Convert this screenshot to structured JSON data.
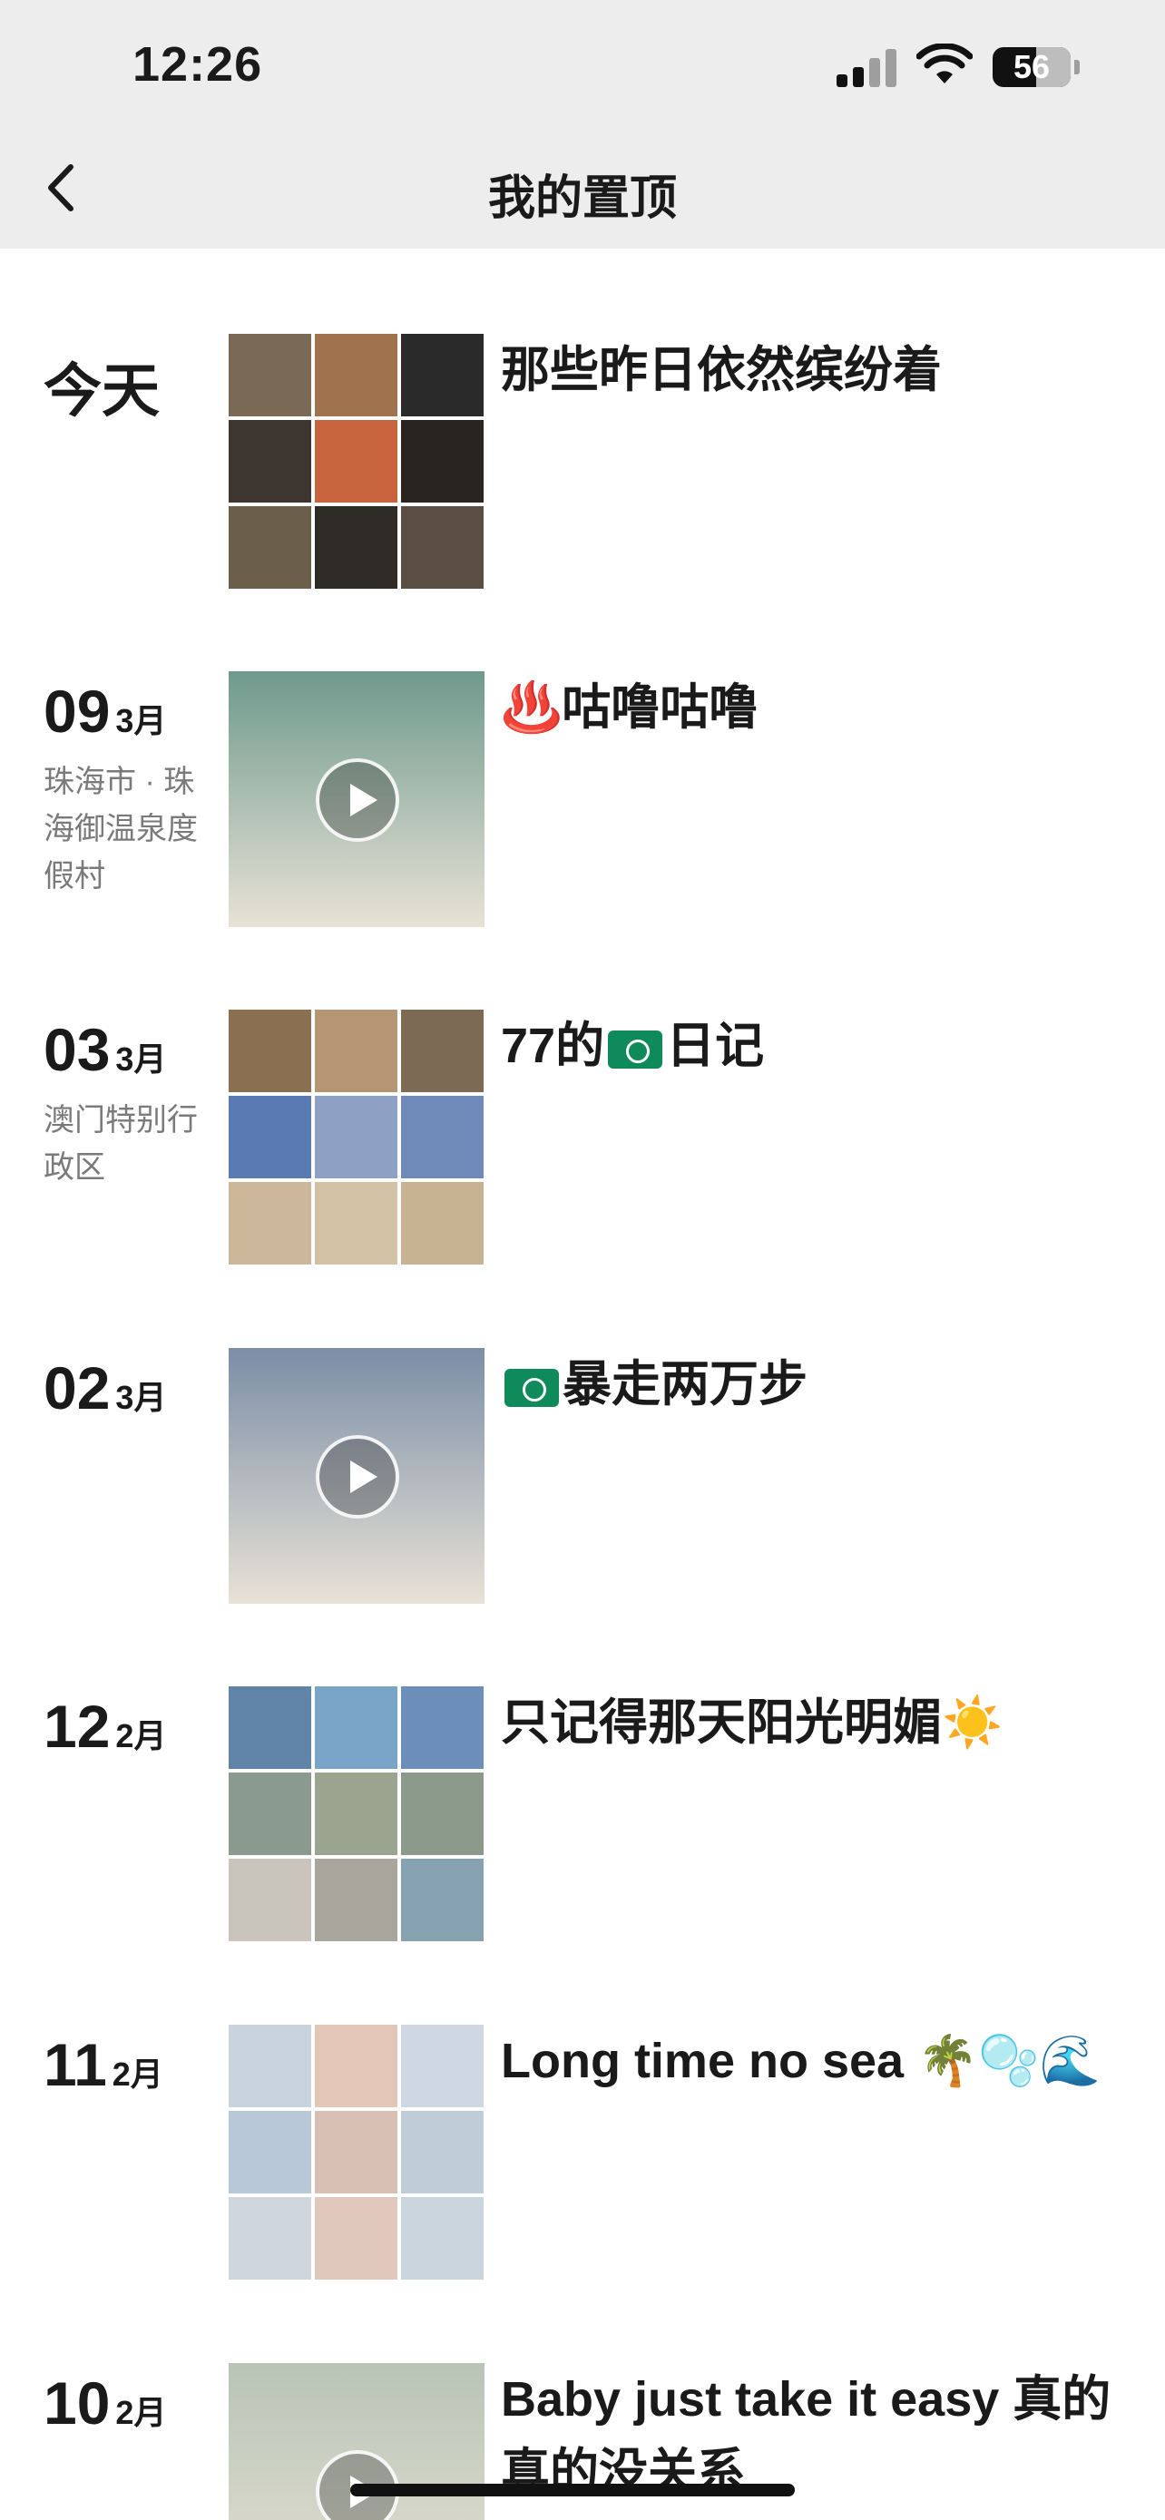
{
  "status_bar": {
    "time": "12:26",
    "battery": "56",
    "battery_level_percent": 56
  },
  "nav": {
    "title": "我的置顶"
  },
  "posts": [
    {
      "date_label": "今天",
      "location": "",
      "type": "grid",
      "caption": "那些昨日依然缤纷着",
      "colors": [
        "#7a6a55",
        "#a0724e",
        "#2a2a2a",
        "#3d3630",
        "#c7633d",
        "#2a2420",
        "#6b5e4a",
        "#2f2b27",
        "#5a4e44"
      ]
    },
    {
      "day": "09",
      "month": "3月",
      "location": "珠海市 · 珠海御温泉度假村",
      "type": "video",
      "caption": "♨️咕噜咕噜",
      "colors": [
        "#6e9a8d"
      ]
    },
    {
      "day": "03",
      "month": "3月",
      "location": "澳门特别行政区",
      "type": "grid",
      "caption": "77的",
      "caption_after_flag": "日记",
      "colors": [
        "#8a6f50",
        "#b59574",
        "#7d6a55",
        "#5a7ab4",
        "#8ea1c4",
        "#6f89b8",
        "#cdb79a",
        "#d3c1a6",
        "#c7b292"
      ]
    },
    {
      "day": "02",
      "month": "3月",
      "location": "",
      "type": "video",
      "caption_after_flag": "暴走两万步",
      "colors": [
        "#7b8ea6"
      ]
    },
    {
      "day": "12",
      "month": "2月",
      "location": "",
      "type": "grid",
      "caption": "只记得那天阳光明媚☀️",
      "colors": [
        "#5f84a8",
        "#7aa3c8",
        "#6b8fb8",
        "#8a9a8e",
        "#9aa48e",
        "#8b9a8a",
        "#c9c5bd",
        "#a7a59c",
        "#86a1b0"
      ]
    },
    {
      "day": "11",
      "month": "2月",
      "location": "",
      "type": "grid",
      "caption": "Long time no sea 🌴🫧🌊",
      "colors": [
        "#c9d3de",
        "#e4c6b8",
        "#cfd8e2",
        "#b9c8d8",
        "#d8c1b4",
        "#c0cdd9",
        "#cfd6de",
        "#e0c8bd",
        "#cad4dd"
      ]
    },
    {
      "day": "10",
      "month": "2月",
      "location": "",
      "type": "video",
      "caption": "Baby just take it easy 真的真的没关系",
      "colors": [
        "#b8c4b6"
      ]
    }
  ]
}
